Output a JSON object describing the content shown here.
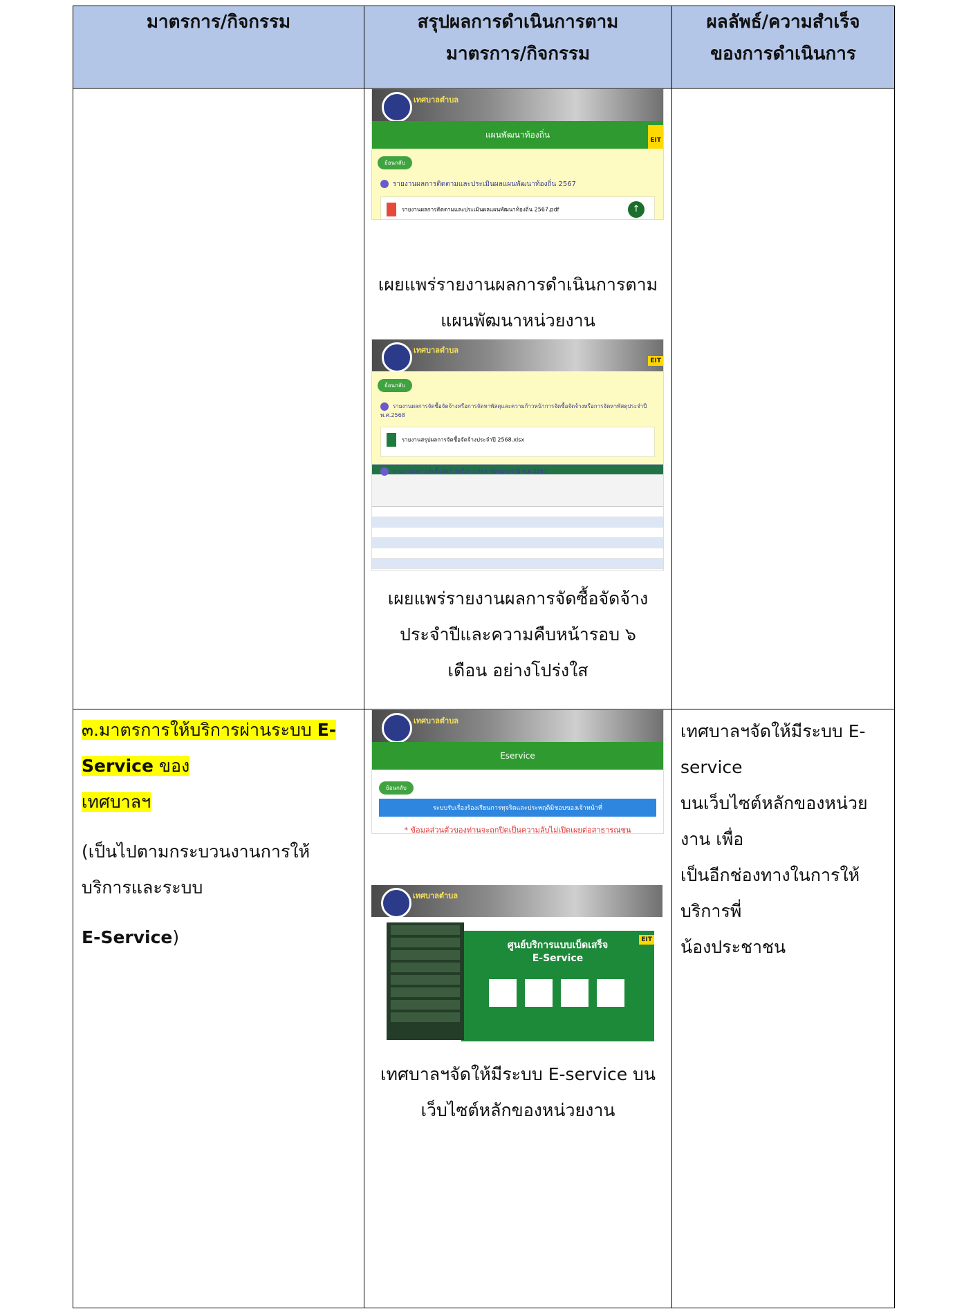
{
  "header": {
    "col1": "มาตรการ/กิจกรรม",
    "col2_line1": "สรุปผลการดำเนินการตาม",
    "col2_line2": "มาตรการ/กิจกรรม",
    "col3_line1": "ผลลัพธ์/ความสำเร็จ",
    "col3_line2": "ของการดำเนินการ"
  },
  "row1": {
    "shot1": {
      "banner_title": "เทศบาลตำบล",
      "green_bar": "แผนพัฒนาท้องถิ่น",
      "eit": "EIT",
      "back_pill": "ย้อนกลับ",
      "post_title": "รายงานผลการติดตามและประเมินผลแผนพัฒนาท้องถิ่น 2567",
      "file_label": "รายงานผลการติดตามและประเมินผลแผนพัฒนาท้องถิ่น 2567.pdf"
    },
    "caption1_line1": "เผยแพร่รายงานผลการดำเนินการตาม",
    "caption1_line2": "แผนพัฒนาหน่วยงาน",
    "shot2": {
      "banner_title": "เทศบาลตำบล",
      "eit": "EIT",
      "back_pill": "ย้อนกลับ",
      "post_title": "รายงานผลการจัดซื้อจัดจ้างหรือการจัดหาพัสดุและความก้าวหน้าการจัดซื้อจัดจ้างหรือการจัดหาพัสดุประจำปี พ.ศ.2568",
      "file_label": "รายงานสรุปผลการจัดซื้อจัดจ้างประจำปี 2568.xlsx",
      "post_title2": "รายงานผลการจัดซื้อจัดจ้างหรือการจัดหาพัสดุประจำปี พ.ศ.2567"
    },
    "caption2_line1": "เผยแพร่รายงานผลการจัดซื้อจัดจ้าง",
    "caption2_line2": "ประจำปีและความคืบหน้ารอบ ๖",
    "caption2_line3": "เดือน อย่างโปร่งใส"
  },
  "row2": {
    "measure_part1": "๓.มาตรการให้บริการผ่านระบบ ",
    "measure_bold": "E-Service",
    "measure_part2": " ของ",
    "measure_line2": "เทศบาลฯ",
    "note_line1": "(เป็นไปตามกระบวนงานการให้บริการและระบบ",
    "note_bold": "E-Service",
    "note_end": ")",
    "shot3": {
      "banner_title": "เทศบาลตำบล",
      "green_bar": "Eservice",
      "back_pill": "ย้อนกลับ",
      "blue_bar": "ระบบรับเรื่องร้องเรียนการทุจริตและประพฤติมิชอบของเจ้าหน้าที่",
      "red_text": "* ข้อมูลส่วนตัวของท่านจะถูกปิดเป็นความลับไม่เปิดเผยต่อสาธารณชน"
    },
    "shot4": {
      "banner_title": "เทศบาลตำบล",
      "hub_title_1": "ศูนย์บริการแบบเบ็ดเสร็จ",
      "hub_title_2": "E-Service",
      "eit": "EIT"
    },
    "caption3_line1": "เทศบาลฯจัดให้มีระบบ E-service บน",
    "caption3_line2": "เว็บไซต์หลักของหน่วยงาน",
    "result_line1": "เทศบาลฯจัดให้มีระบบ E-service",
    "result_line2": "บนเว็บไซต์หลักของหน่วยงาน เพื่อ",
    "result_line3": "เป็นอีกช่องทางในการให้บริการพี่",
    "result_line4": "น้องประชาชน"
  }
}
